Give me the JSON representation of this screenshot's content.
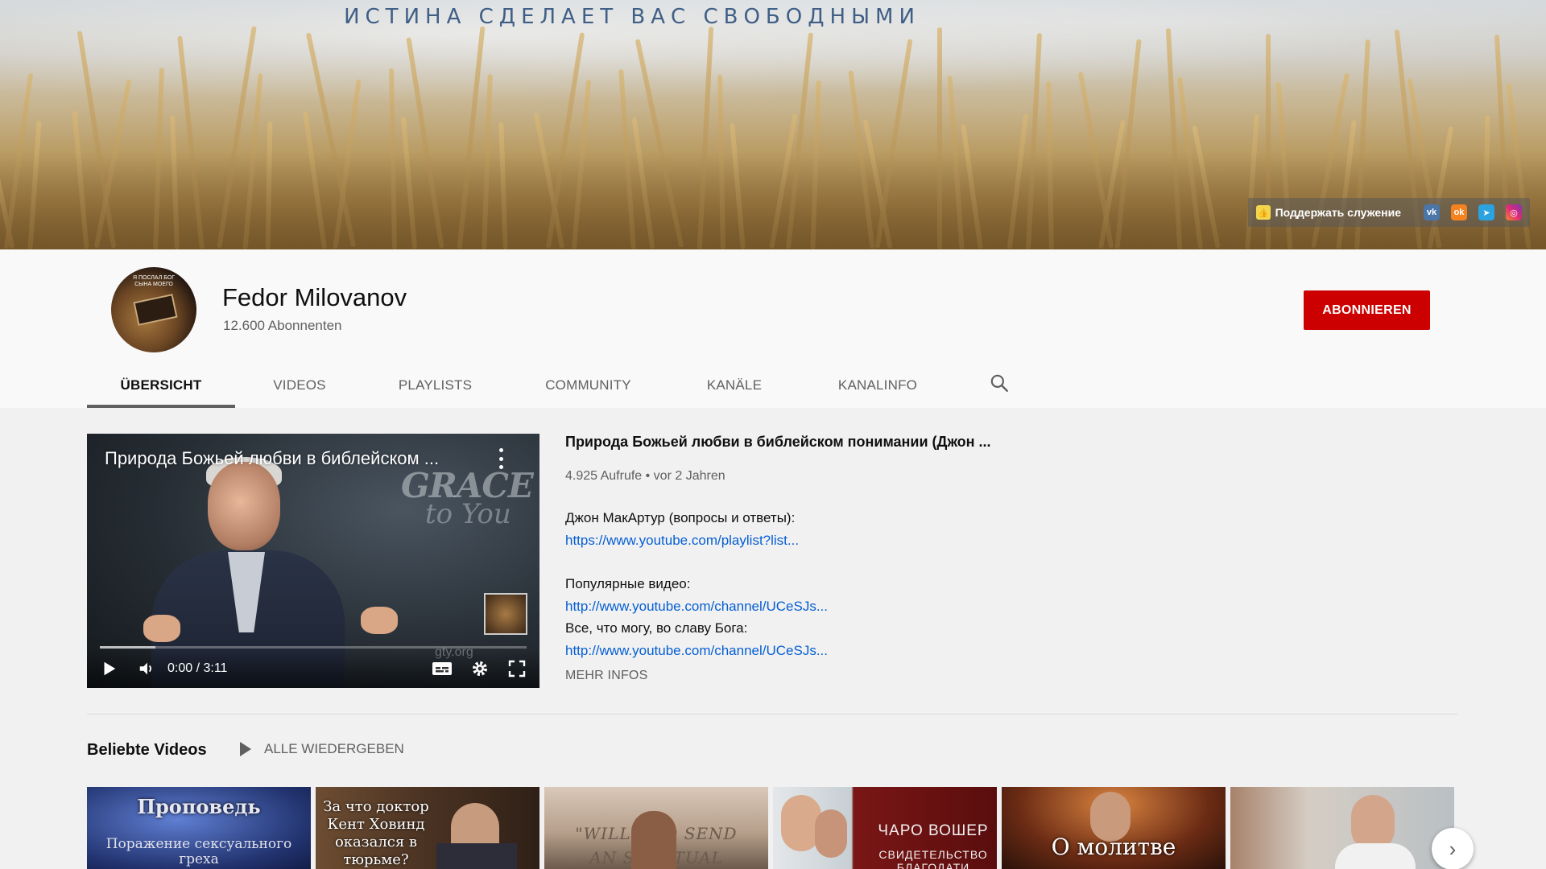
{
  "banner": {
    "tagline": "ИСТИНА СДЕЛАЕТ ВАС СВОБОДНЫМИ",
    "support_label": "Поддержать служение",
    "social_links": [
      {
        "name": "vk-icon",
        "glyph": "vk",
        "color": "#4a76a8"
      },
      {
        "name": "odnoklassniki-icon",
        "glyph": "ok",
        "color": "#f58220"
      },
      {
        "name": "telegram-icon",
        "glyph": "➤",
        "color": "#2aa3e0"
      },
      {
        "name": "instagram-icon",
        "glyph": "◎",
        "color": "#dd2a7b"
      }
    ]
  },
  "channel": {
    "name": "Fedor Milovanov",
    "subscribers": "12.600 Abonnenten",
    "subscribe_label": "ABONNIEREN",
    "avatar_text": "Я ПОСЛАЛ БОГ СЫНА МОЕГО"
  },
  "tabs": [
    {
      "label": "ÜBERSICHT",
      "active": true
    },
    {
      "label": "VIDEOS",
      "active": false
    },
    {
      "label": "PLAYLISTS",
      "active": false
    },
    {
      "label": "COMMUNITY",
      "active": false
    },
    {
      "label": "KANÄLE",
      "active": false
    },
    {
      "label": "KANALINFO",
      "active": false
    }
  ],
  "featured": {
    "player_title": "Природа Божьей любви в библейском ...",
    "time": "0:00 / 3:11",
    "progress_fraction": 0.13,
    "overlay_brand_1": "GRACE",
    "overlay_brand_2": "to You",
    "overlay_site": "gty.org",
    "title": "Природа Божьей любви в библейском понимании (Джон ...",
    "meta": "4.925 Aufrufe • vor 2 Jahren",
    "desc_1": "Джон МакАртур (вопросы и ответы):",
    "link_1": "https://www.youtube.com/playlist?list...",
    "desc_2": "Популярные видео:",
    "link_2": "http://www.youtube.com/channel/UCeSJs...",
    "desc_3": "Все, что могу, во славу Бога:",
    "link_3": "http://www.youtube.com/channel/UCeSJs...",
    "more_label": "MEHR INFOS"
  },
  "shelf": {
    "title": "Beliebte Videos",
    "play_all": "ALLE WIEDERGEBEN",
    "thumbs": [
      {
        "line1": "Проповедь",
        "line2": "Поражение сексуального греха"
      },
      {
        "line1": "За что доктор Кент Ховинд оказался в тюрьме?",
        "line2": ""
      },
      {
        "line1": "\"WILL GOD SEND",
        "line2": "AN SPIRITUAL"
      },
      {
        "line1": "ЧАРО ВОШЕР",
        "line2": "СВИДЕТЕЛЬСТВО БЛАГОДАТИ"
      },
      {
        "line1": "О молитве",
        "line2": ""
      },
      {
        "line1": "",
        "line2": ""
      }
    ]
  },
  "colors": {
    "subscribe": "#cc0000",
    "link": "#065fd4",
    "muted": "#606060"
  }
}
